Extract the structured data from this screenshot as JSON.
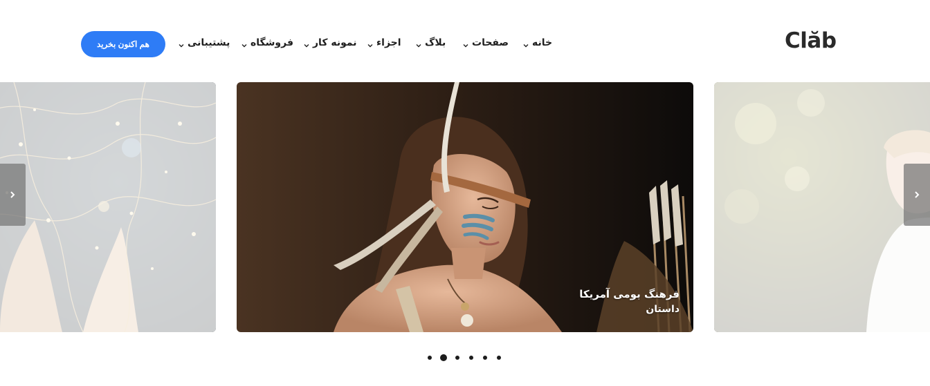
{
  "brand": {
    "logo_text_a": "Cl",
    "logo_text_b": "ă",
    "logo_text_c": "b"
  },
  "nav": {
    "items": [
      {
        "label": "خانه"
      },
      {
        "label": "صفحات"
      },
      {
        "label": "بلاگ"
      },
      {
        "label": "اجزاء"
      },
      {
        "label": "نمونه کار"
      },
      {
        "label": "فروشگاه"
      },
      {
        "label": "پشتیبانی"
      }
    ],
    "buy_label": "هم اکنون بخرید"
  },
  "carousel": {
    "active_index": 1,
    "dot_count": 6,
    "center_caption": {
      "title": "فرهنگ بومی آمریکا",
      "subtitle": "داستان"
    }
  },
  "colors": {
    "accent": "#2e7cf6",
    "text": "#1f1f1f"
  }
}
